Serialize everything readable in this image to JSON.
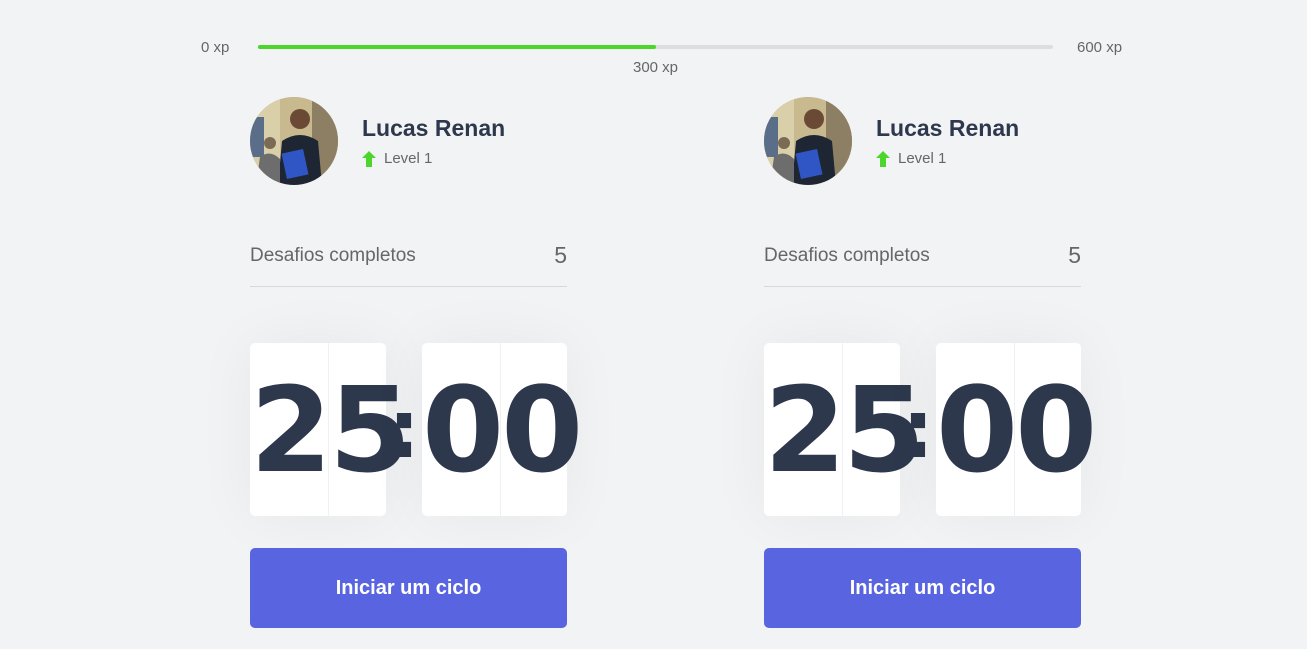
{
  "xp": {
    "min_label": "0 xp",
    "max_label": "600 xp",
    "current_label": "300 xp",
    "progress_fraction": 0.5,
    "fill_color": "#4cd62b",
    "track_color": "#dcdde0"
  },
  "columns": [
    {
      "profile": {
        "name": "Lucas Renan",
        "level_label": "Level 1",
        "level_icon": "level-up-arrow-icon"
      },
      "challenges": {
        "label": "Desafios completos",
        "count": "5"
      },
      "countdown": {
        "minute_tens": "2",
        "minute_ones": "5",
        "separator": ":",
        "second_tens": "0",
        "second_ones": "0"
      },
      "button_label": "Iniciar um ciclo"
    },
    {
      "profile": {
        "name": "Lucas Renan",
        "level_label": "Level 1",
        "level_icon": "level-up-arrow-icon"
      },
      "challenges": {
        "label": "Desafios completos",
        "count": "5"
      },
      "countdown": {
        "minute_tens": "2",
        "minute_ones": "5",
        "separator": ":",
        "second_tens": "0",
        "second_ones": "0"
      },
      "button_label": "Iniciar um ciclo"
    }
  ],
  "colors": {
    "background": "#f2f3f5",
    "title": "#2e384d",
    "text": "#666666",
    "accent_blue": "#5965e0",
    "accent_green": "#4cd62b"
  }
}
